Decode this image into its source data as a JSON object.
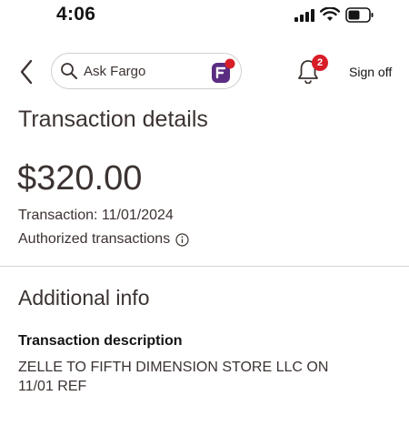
{
  "status_bar": {
    "time": "4:06"
  },
  "nav": {
    "search_placeholder": "Ask Fargo",
    "notification_count": "2",
    "sign_off_label": "Sign off"
  },
  "details": {
    "title": "Transaction details",
    "amount": "$320.00",
    "transaction_date": "Transaction: 11/01/2024",
    "authorized_label": "Authorized transactions"
  },
  "additional": {
    "title": "Additional info",
    "description_label": "Transaction description",
    "description_value": "ZELLE TO FIFTH DIMENSION STORE LLC ON 11/01 REF"
  },
  "colors": {
    "brand_red": "#d71e28",
    "brand_purple": "#5a2d82",
    "text": "#3b3331"
  },
  "icons": [
    "signal-icon",
    "wifi-icon",
    "battery-icon",
    "back-chevron-icon",
    "search-icon",
    "fargo-logo-icon",
    "bell-icon",
    "info-icon"
  ]
}
